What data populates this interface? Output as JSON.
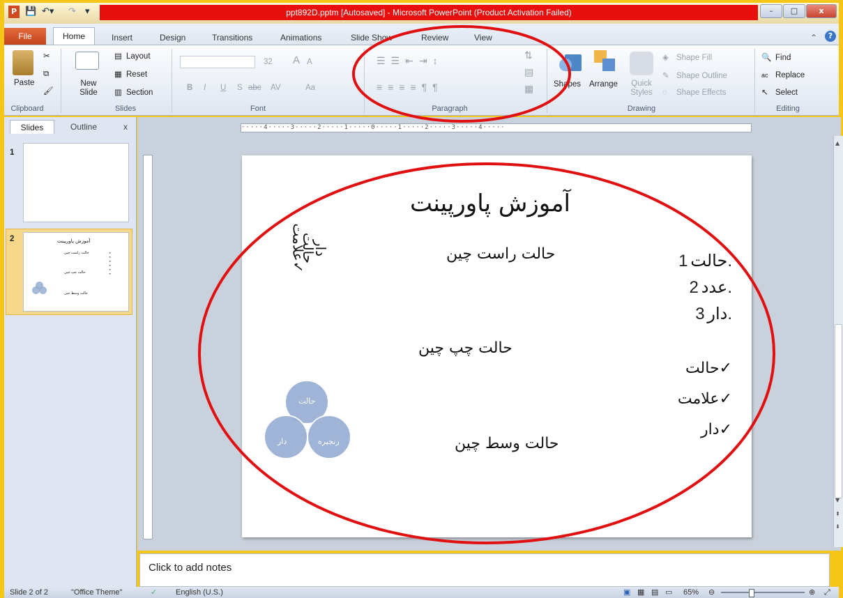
{
  "window": {
    "title": "ppt892D.pptm [Autosaved] - Microsoft PowerPoint (Product Activation Failed)",
    "min": "–",
    "max": "□",
    "close": "x"
  },
  "tabs": {
    "file": "File",
    "items": [
      "Home",
      "Insert",
      "Design",
      "Transitions",
      "Animations",
      "Slide Show",
      "Review",
      "View"
    ]
  },
  "ribbon": {
    "clipboard": {
      "paste": "Paste",
      "label": "Clipboard"
    },
    "slides": {
      "new_slide": "New Slide",
      "layout": "Layout",
      "reset": "Reset",
      "section": "Section",
      "label": "Slides"
    },
    "font": {
      "size": "32",
      "bold": "B",
      "italic": "I",
      "underline": "U",
      "shadow": "S",
      "strike": "abc",
      "spacing": "AV",
      "case": "Aa",
      "grow": "A",
      "shrink": "A",
      "label": "Font"
    },
    "paragraph": {
      "label": "Paragraph"
    },
    "drawing": {
      "shapes": "Shapes",
      "arrange": "Arrange",
      "quick_styles": "Quick Styles",
      "shape_fill": "Shape Fill",
      "shape_outline": "Shape Outline",
      "shape_effects": "Shape Effects",
      "label": "Drawing"
    },
    "editing": {
      "find": "Find",
      "replace": "Replace",
      "select": "Select",
      "label": "Editing"
    }
  },
  "pane": {
    "slides_tab": "Slides",
    "outline_tab": "Outline",
    "close": "x",
    "thumb1_num": "1",
    "thumb2_num": "2"
  },
  "ruler": {
    "h_ticks": "·····4·····3·····2·····1·····0·····1·····2·····3·····4·····"
  },
  "slide": {
    "title": "آموزش پاورپینت",
    "right_align": "حالت راست چین",
    "left_align": "حالت چپ چین",
    "center_align": "حالت وسط چین",
    "numbered": [
      {
        "num": "1.",
        "text": "حالت"
      },
      {
        "num": "2.",
        "text": "عدد"
      },
      {
        "num": "3.",
        "text": "دار"
      }
    ],
    "checked": [
      "✓حالت",
      "✓علامت",
      "✓دار"
    ],
    "venn": [
      "حالت",
      "دار",
      "زنجیره"
    ]
  },
  "notes": {
    "placeholder": "Click to add notes"
  },
  "status": {
    "slide": "Slide 2 of 2",
    "theme": "\"Office Theme\"",
    "language": "English (U.S.)",
    "zoom": "65%"
  },
  "colors": {
    "annotation": "#e01010",
    "venn": "#8fa8cf",
    "title_red": "#e80f0f",
    "accent_frame": "#f5c518"
  }
}
